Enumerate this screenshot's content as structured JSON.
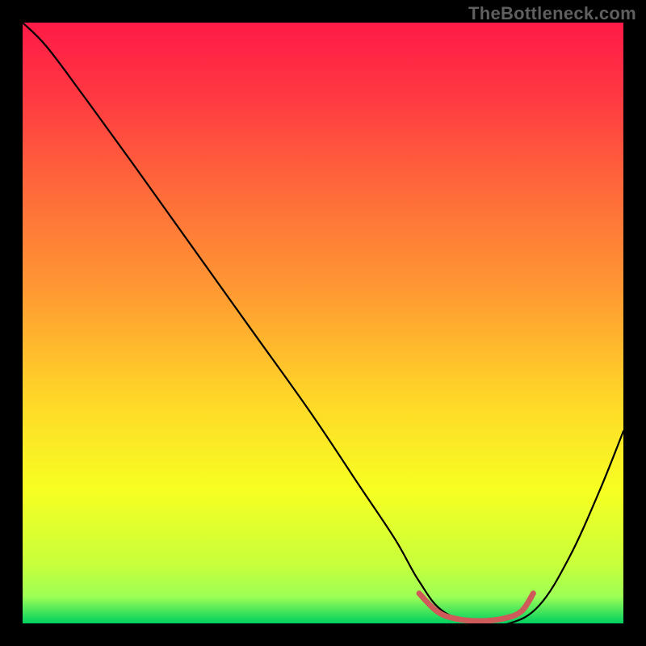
{
  "watermark": "TheBottleneck.com",
  "chart_data": {
    "type": "line",
    "title": "",
    "xlabel": "",
    "ylabel": "",
    "xlim": [
      0,
      100
    ],
    "ylim": [
      0,
      100
    ],
    "grid": false,
    "legend": false,
    "background_gradient": {
      "type": "vertical",
      "stops": [
        {
          "pos": 0.0,
          "color": "#ff1a47"
        },
        {
          "pos": 0.12,
          "color": "#ff3842"
        },
        {
          "pos": 0.28,
          "color": "#ff6a3a"
        },
        {
          "pos": 0.45,
          "color": "#ff9a32"
        },
        {
          "pos": 0.62,
          "color": "#ffd528"
        },
        {
          "pos": 0.78,
          "color": "#f7ff22"
        },
        {
          "pos": 0.9,
          "color": "#c8ff3a"
        },
        {
          "pos": 0.955,
          "color": "#9eff55"
        },
        {
          "pos": 1.0,
          "color": "#00d060"
        }
      ]
    },
    "series": [
      {
        "name": "bottleneck-curve",
        "color": "#000000",
        "width": 2.2,
        "x": [
          0,
          4,
          10,
          18,
          28,
          38,
          48,
          56,
          62,
          66,
          70,
          76,
          81,
          86,
          91,
          96,
          100
        ],
        "y": [
          100,
          96,
          88,
          77,
          63,
          49,
          35,
          23,
          14,
          7,
          2,
          0,
          0,
          3,
          11,
          22,
          32
        ]
      }
    ],
    "highlight": {
      "name": "optimal-range",
      "color": "#cf5a5a",
      "width": 7,
      "x": [
        66,
        69,
        72,
        76,
        80,
        83,
        85
      ],
      "y": [
        5,
        2,
        0.8,
        0.4,
        0.8,
        2,
        5
      ]
    }
  }
}
